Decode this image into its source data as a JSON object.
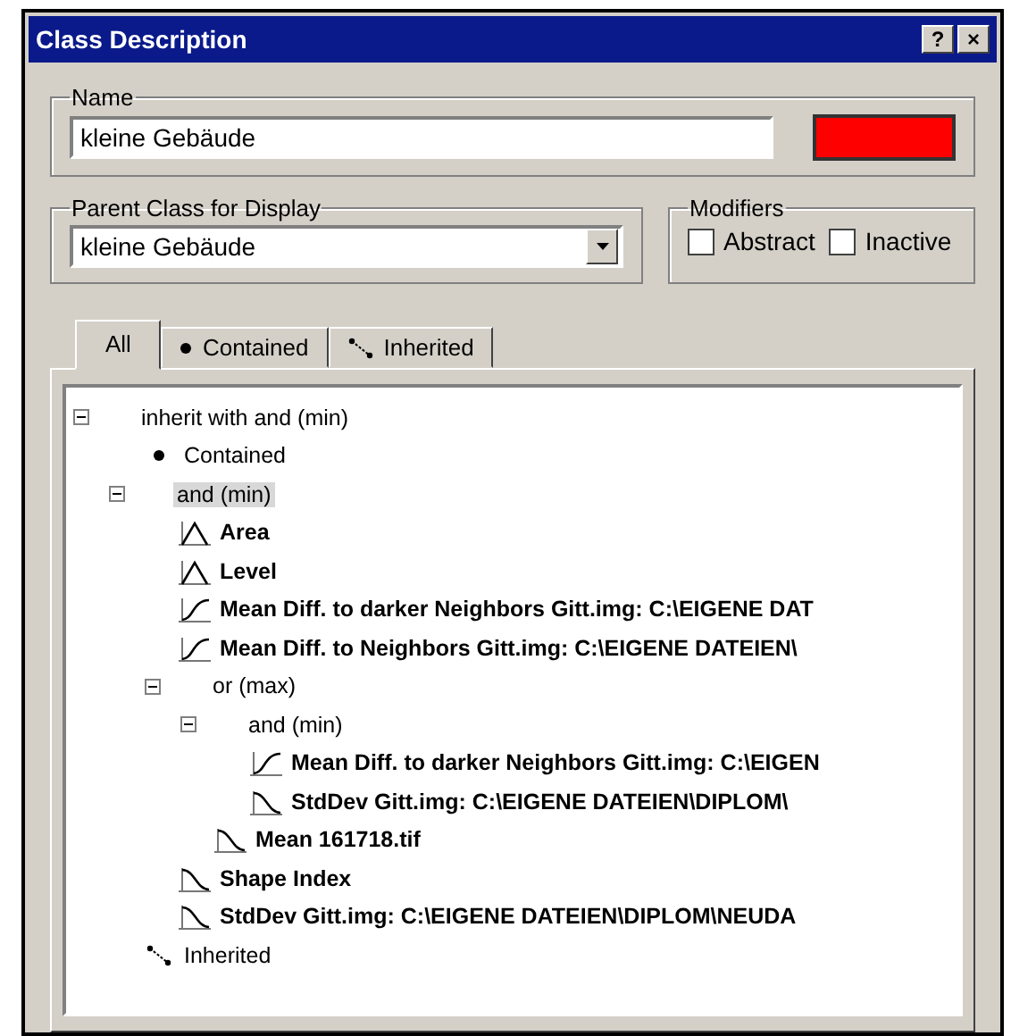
{
  "window": {
    "title": "Class Description",
    "buttons": [
      "?",
      "×"
    ]
  },
  "name_group": {
    "legend": "Name",
    "value": "kleine Gebäude",
    "color": "#ff0000"
  },
  "parent_group": {
    "legend": "Parent Class for Display",
    "value": "kleine Gebäude"
  },
  "modifiers": {
    "legend": "Modifiers",
    "options": [
      {
        "label": "Abstract",
        "checked": false
      },
      {
        "label": "Inactive",
        "checked": false
      }
    ]
  },
  "tabs": [
    {
      "label": "All",
      "kind": "plain",
      "selected": true
    },
    {
      "label": "Contained",
      "kind": "contained",
      "selected": false
    },
    {
      "label": "Inherited",
      "kind": "inherited",
      "selected": false
    }
  ],
  "tree": [
    {
      "label": "inherit with and (min)",
      "kind": "operator",
      "expanded": true,
      "selected": false,
      "children": [
        {
          "label": "Contained",
          "kind": "contained",
          "selected": false
        },
        {
          "label": "and (min)",
          "kind": "operator",
          "expanded": true,
          "selected": true,
          "children": [
            {
              "label": "Area",
              "kind": "bell",
              "selected": false
            },
            {
              "label": "Level",
              "kind": "bell",
              "selected": false
            },
            {
              "label": "Mean Diff. to darker Neighbors Gitt.img:  C:\\EIGENE DAT",
              "kind": "rising",
              "selected": false
            },
            {
              "label": "Mean Diff. to Neighbors Gitt.img:  C:\\EIGENE DATEIEN\\",
              "kind": "rising",
              "selected": false
            },
            {
              "label": "or (max)",
              "kind": "operator",
              "expanded": true,
              "selected": false,
              "children": [
                {
                  "label": "and (min)",
                  "kind": "operator",
                  "expanded": true,
                  "selected": false,
                  "children": [
                    {
                      "label": "Mean Diff. to darker Neighbors Gitt.img:  C:\\EIGEN",
                      "kind": "rising",
                      "selected": false
                    },
                    {
                      "label": "StdDev Gitt.img:  C:\\EIGENE DATEIEN\\DIPLOM\\",
                      "kind": "falling",
                      "selected": false
                    }
                  ]
                },
                {
                  "label": "Mean 161718.tif",
                  "kind": "falling",
                  "selected": false
                }
              ]
            },
            {
              "label": "Shape Index",
              "kind": "falling",
              "selected": false
            },
            {
              "label": "StdDev Gitt.img:  C:\\EIGENE DATEIEN\\DIPLOM\\NEUDA",
              "kind": "falling",
              "selected": false
            }
          ]
        },
        {
          "label": "Inherited",
          "kind": "inherited",
          "selected": false
        }
      ]
    }
  ]
}
